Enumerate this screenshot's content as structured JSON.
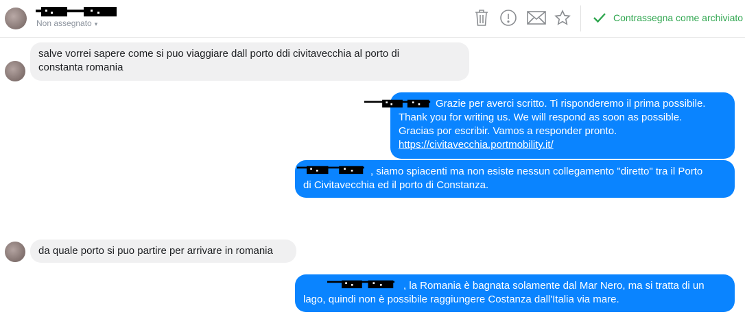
{
  "header": {
    "contact_name": "",
    "assignment_status": "Non assegnato",
    "assignment_chevron": "▾",
    "icons": [
      "trash-icon",
      "alert-icon",
      "mail-icon",
      "star-icon",
      "check-icon"
    ],
    "archive_label": "Contrassegna come archiviato",
    "accent_color": "#2fa64f"
  },
  "messages": [
    {
      "direction": "incoming",
      "lines": [
        "salve vorrei sapere come si puo viaggiare dall porto ddi civitavecchia al porto di",
        "constanta romania"
      ]
    },
    {
      "direction": "outgoing",
      "lines": [
        "Grazie per averci scritto. Ti risponderemo il prima possibile.",
        "Thank you for writing us. We will respond as soon as possible.",
        "Gracias por escribir. Vamos a responder pronto."
      ],
      "link": "https://civitavecchia.portmobility.it/"
    },
    {
      "direction": "outgoing",
      "lines": [
        ", siamo spiacenti ma non esiste nessun collegamento \"diretto\" tra il Porto",
        "di Civitavecchia ed il porto di Constanza."
      ]
    },
    {
      "direction": "incoming",
      "lines": [
        "da quale porto si puo partire per arrivare in romania"
      ]
    },
    {
      "direction": "outgoing",
      "lines": [
        ", la Romania è bagnata solamente dal Mar Nero, ma si tratta di un",
        "lago, quindi non è possibile raggiungere Costanza dall'Italia via mare."
      ]
    }
  ],
  "colors": {
    "outgoing_bubble": "#0a84ff",
    "incoming_bubble": "#f0f0f1"
  }
}
